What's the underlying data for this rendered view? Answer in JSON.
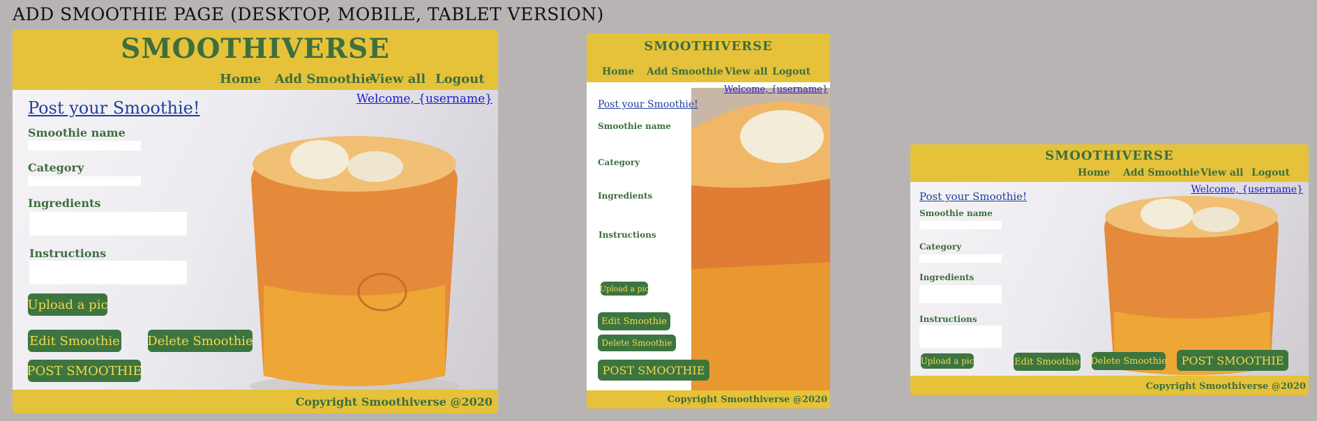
{
  "page": {
    "title": "ADD SMOOTHIE  PAGE (DESKTOP, MOBILE, TABLET VERSION)"
  },
  "brand": "SMOOTHIVERSE",
  "nav": {
    "home": "Home",
    "add": "Add Smoothie",
    "view_all": "View all",
    "logout": "Logout"
  },
  "welcome": "Welcome, {username}",
  "form": {
    "title": "Post your Smoothie!",
    "name_label": "Smoothie name",
    "category_label": "Category",
    "ingredients_label": "Ingredients",
    "instructions_label": "Instructions",
    "name_value": "",
    "category_value": "",
    "ingredients_value": "",
    "instructions_value": ""
  },
  "buttons": {
    "upload": "Upload a pic",
    "edit": "Edit Smoothie",
    "delete": "Delete Smoothie",
    "post": "POST SMOOTHIE"
  },
  "footer": {
    "copyright": "Copyright Smoothiverse @2020"
  },
  "colors": {
    "yellow": "#e5c23a",
    "green": "#3d7540",
    "button_text": "#f4d94a",
    "link_blue": "#1a1ad0"
  },
  "icons": {
    "photo": "smoothie-glass-photo"
  }
}
